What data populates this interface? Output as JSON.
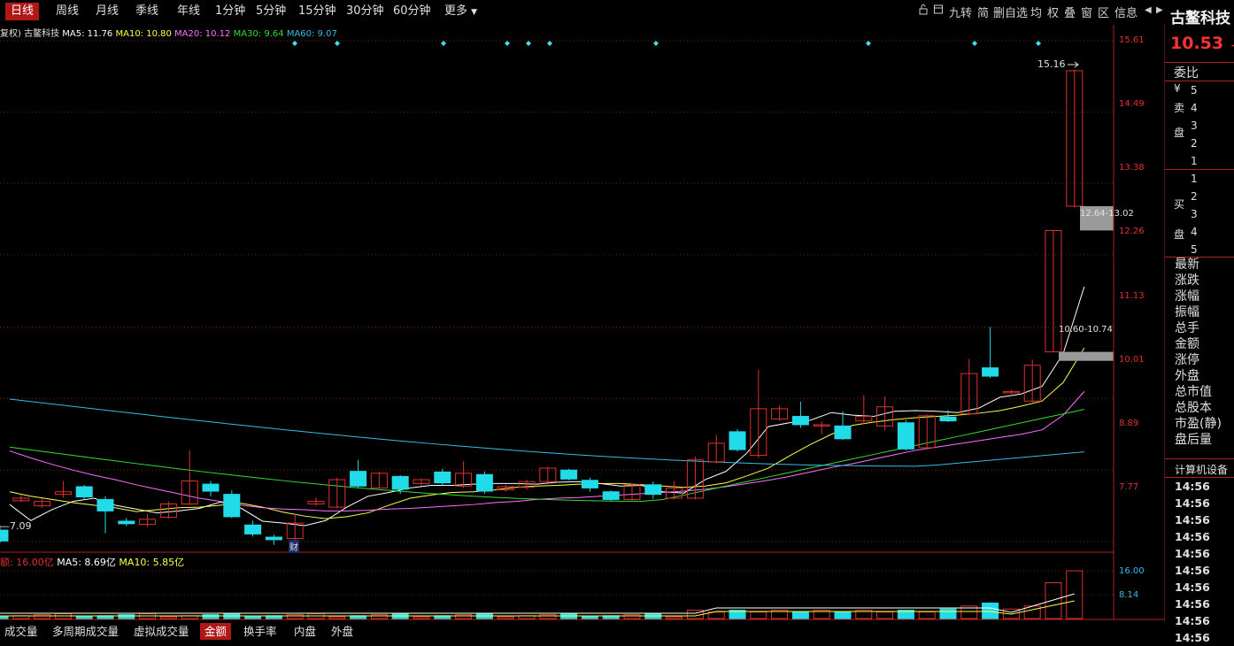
{
  "tabs": [
    "日线",
    "周线",
    "月线",
    "季线",
    "年线",
    "1分钟",
    "5分钟",
    "15分钟",
    "30分钟",
    "60分钟",
    "更多"
  ],
  "active_tab": 0,
  "toolbar": {
    "icons": [
      "lock-icon",
      "window-icon"
    ],
    "items": [
      "九转",
      "简",
      "删自选",
      "均",
      "权",
      "叠",
      "窗",
      "区",
      "信息"
    ],
    "prev_icon": "triangle-left-icon",
    "next_icon": "triangle-right-icon"
  },
  "stock": {
    "name": "古鳌科技",
    "price": "10.53",
    "price_suffix": "+"
  },
  "ma_line": {
    "prefix": "复权) 古鳌科技",
    "ma5": "MA5: 11.76",
    "ma10": "MA10: 10.80",
    "ma20": "MA20: 10.12",
    "ma30": "MA30: 9.64",
    "ma60": "MA60: 9.07"
  },
  "vol_line": {
    "label": "额: 16.00亿",
    "ma5": "MA5: 8.69亿",
    "ma10": "MA10: 5.85亿"
  },
  "price_axis": [
    "15.61",
    "14.49",
    "13.38",
    "12.26",
    "11.13",
    "10.01",
    "8.89",
    "7.77"
  ],
  "vol_axis": [
    "16.00",
    "8.14"
  ],
  "annotations": {
    "high": "15.16",
    "low_left": "7.09",
    "zone_upper": "12.64-13.02",
    "zone_lower": "10.60-10.74",
    "fin_marker": "财"
  },
  "right_panel": {
    "weibi": "委比",
    "sell_side": [
      "¥",
      "卖",
      "盘"
    ],
    "buy_side": [
      "买",
      "盘"
    ],
    "sell_levels": [
      "5",
      "4",
      "3",
      "2",
      "1"
    ],
    "buy_levels": [
      "1",
      "2",
      "3",
      "4",
      "5"
    ],
    "stats": [
      "最新",
      "涨跌",
      "涨幅",
      "振幅",
      "总手",
      "金额",
      "涨停",
      "外盘",
      "总市值",
      "总股本",
      "市盈(静)",
      "盘后量"
    ],
    "section": "计算机设备",
    "ticks": [
      "14:56",
      "14:56",
      "14:56",
      "14:56",
      "14:56",
      "14:56",
      "14:56",
      "14:56",
      "14:56",
      "14:56"
    ]
  },
  "bottom_tabs": [
    "成交量",
    "多周期成交量",
    "虚拟成交量",
    "金额",
    "换手率",
    "内盘",
    "外盘"
  ],
  "bottom_active": 3,
  "colors": {
    "up": "#e03030",
    "down": "#22dbe8",
    "ma5": "#ffffff",
    "ma10": "#ffff40",
    "ma20": "#ff70ff",
    "ma30": "#33dd33",
    "ma60": "#38bbe6",
    "grid": "#7a1515"
  },
  "chart_data": {
    "type": "candlestick",
    "ylim": [
      7.0,
      15.8
    ],
    "candles": [
      {
        "o": 7.95,
        "c": 7.78,
        "h": 8.02,
        "l": 7.75
      },
      {
        "o": 8.41,
        "c": 8.45,
        "h": 8.5,
        "l": 8.39
      },
      {
        "o": 8.33,
        "c": 8.4,
        "h": 8.45,
        "l": 8.3
      },
      {
        "o": 8.51,
        "c": 8.55,
        "h": 8.72,
        "l": 8.46
      },
      {
        "o": 8.63,
        "c": 8.47,
        "h": 8.66,
        "l": 8.43
      },
      {
        "o": 8.43,
        "c": 8.25,
        "h": 8.48,
        "l": 7.9
      },
      {
        "o": 8.09,
        "c": 8.05,
        "h": 8.14,
        "l": 8.01
      },
      {
        "o": 8.04,
        "c": 8.12,
        "h": 8.2,
        "l": 8.0
      },
      {
        "o": 8.15,
        "c": 8.36,
        "h": 8.4,
        "l": 8.13
      },
      {
        "o": 8.36,
        "c": 8.72,
        "h": 9.2,
        "l": 8.34
      },
      {
        "o": 8.67,
        "c": 8.56,
        "h": 8.72,
        "l": 8.48
      },
      {
        "o": 8.51,
        "c": 8.16,
        "h": 8.57,
        "l": 8.14
      },
      {
        "o": 8.03,
        "c": 7.89,
        "h": 8.1,
        "l": 7.85
      },
      {
        "o": 7.84,
        "c": 7.8,
        "h": 7.88,
        "l": 7.72
      },
      {
        "o": 7.82,
        "c": 8.06,
        "h": 8.2,
        "l": 7.8
      },
      {
        "o": 8.36,
        "c": 8.4,
        "h": 8.46,
        "l": 8.33
      },
      {
        "o": 8.31,
        "c": 8.74,
        "h": 8.77,
        "l": 8.29
      },
      {
        "o": 8.87,
        "c": 8.64,
        "h": 9.05,
        "l": 8.61
      },
      {
        "o": 8.61,
        "c": 8.84,
        "h": 8.86,
        "l": 8.6
      },
      {
        "o": 8.79,
        "c": 8.59,
        "h": 8.81,
        "l": 8.52
      },
      {
        "o": 8.68,
        "c": 8.74,
        "h": 8.76,
        "l": 8.64
      },
      {
        "o": 8.86,
        "c": 8.69,
        "h": 8.91,
        "l": 8.64
      },
      {
        "o": 8.64,
        "c": 8.84,
        "h": 9.03,
        "l": 8.61
      },
      {
        "o": 8.82,
        "c": 8.56,
        "h": 8.87,
        "l": 8.52
      },
      {
        "o": 8.58,
        "c": 8.63,
        "h": 8.66,
        "l": 8.55
      },
      {
        "o": 8.62,
        "c": 8.71,
        "h": 8.74,
        "l": 8.59
      },
      {
        "o": 8.71,
        "c": 8.92,
        "h": 8.94,
        "l": 8.69
      },
      {
        "o": 8.89,
        "c": 8.75,
        "h": 8.91,
        "l": 8.73
      },
      {
        "o": 8.73,
        "c": 8.61,
        "h": 8.77,
        "l": 8.55
      },
      {
        "o": 8.55,
        "c": 8.43,
        "h": 8.57,
        "l": 8.4
      },
      {
        "o": 8.43,
        "c": 8.66,
        "h": 8.68,
        "l": 8.4
      },
      {
        "o": 8.66,
        "c": 8.51,
        "h": 8.71,
        "l": 8.44
      },
      {
        "o": 8.45,
        "c": 8.61,
        "h": 8.72,
        "l": 8.43
      },
      {
        "o": 8.45,
        "c": 9.05,
        "h": 9.1,
        "l": 8.43
      },
      {
        "o": 9.02,
        "c": 9.31,
        "h": 9.44,
        "l": 9.0
      },
      {
        "o": 9.49,
        "c": 9.21,
        "h": 9.53,
        "l": 9.18
      },
      {
        "o": 9.12,
        "c": 9.85,
        "h": 10.46,
        "l": 9.08
      },
      {
        "o": 9.69,
        "c": 9.85,
        "h": 9.9,
        "l": 9.66
      },
      {
        "o": 9.73,
        "c": 9.6,
        "h": 9.96,
        "l": 9.55
      },
      {
        "o": 9.58,
        "c": 9.6,
        "h": 9.65,
        "l": 9.45
      },
      {
        "o": 9.58,
        "c": 9.38,
        "h": 9.81,
        "l": 9.36
      },
      {
        "o": 9.66,
        "c": 9.73,
        "h": 10.06,
        "l": 9.61
      },
      {
        "o": 9.58,
        "c": 9.88,
        "h": 10.04,
        "l": 9.52
      },
      {
        "o": 9.63,
        "c": 9.22,
        "h": 9.67,
        "l": 9.2
      },
      {
        "o": 9.24,
        "c": 9.74,
        "h": 9.76,
        "l": 9.22
      },
      {
        "o": 9.72,
        "c": 9.66,
        "h": 9.83,
        "l": 9.64
      },
      {
        "o": 9.77,
        "c": 10.4,
        "h": 10.63,
        "l": 9.75
      },
      {
        "o": 10.49,
        "c": 10.36,
        "h": 11.13,
        "l": 10.33
      },
      {
        "o": 10.1,
        "c": 10.12,
        "h": 10.15,
        "l": 10.08
      },
      {
        "o": 9.97,
        "c": 10.53,
        "h": 10.62,
        "l": 9.95
      },
      {
        "o": 10.74,
        "c": 12.64,
        "h": 12.64,
        "l": 10.74
      },
      {
        "o": 13.02,
        "c": 15.14,
        "h": 15.16,
        "l": 13.0
      }
    ],
    "ma5": [
      8.35,
      8.1,
      8.27,
      8.4,
      8.45,
      8.34,
      8.28,
      8.22,
      8.25,
      8.29,
      8.39,
      8.29,
      8.09,
      8.06,
      8.02,
      8.1,
      8.31,
      8.48,
      8.54,
      8.61,
      8.65,
      8.65,
      8.67,
      8.68,
      8.68,
      8.67,
      8.7,
      8.71,
      8.68,
      8.64,
      8.65,
      8.55,
      8.53,
      8.74,
      8.87,
      9.16,
      9.57,
      9.63,
      9.67,
      9.79,
      9.75,
      9.73,
      9.81,
      9.82,
      9.81,
      9.79,
      9.86,
      10.03,
      10.08,
      10.2,
      10.71,
      11.76
    ],
    "ma10": [
      8.55,
      8.48,
      8.43,
      8.38,
      8.34,
      8.3,
      8.24,
      8.27,
      8.3,
      8.31,
      8.34,
      8.37,
      8.31,
      8.23,
      8.17,
      8.13,
      8.16,
      8.22,
      8.34,
      8.45,
      8.5,
      8.54,
      8.55,
      8.58,
      8.62,
      8.64,
      8.65,
      8.67,
      8.68,
      8.68,
      8.66,
      8.64,
      8.62,
      8.64,
      8.69,
      8.8,
      8.92,
      9.11,
      9.29,
      9.45,
      9.59,
      9.64,
      9.68,
      9.71,
      9.73,
      9.75,
      9.78,
      9.82,
      9.89,
      9.97,
      10.26,
      10.8
    ],
    "ma20": [
      9.19,
      9.08,
      8.98,
      8.89,
      8.81,
      8.74,
      8.66,
      8.59,
      8.52,
      8.45,
      8.4,
      8.34,
      8.3,
      8.28,
      8.27,
      8.25,
      8.25,
      8.26,
      8.28,
      8.29,
      8.31,
      8.33,
      8.35,
      8.38,
      8.4,
      8.43,
      8.45,
      8.46,
      8.48,
      8.5,
      8.52,
      8.54,
      8.56,
      8.59,
      8.63,
      8.68,
      8.73,
      8.79,
      8.86,
      8.93,
      8.99,
      9.06,
      9.13,
      9.2,
      9.25,
      9.3,
      9.35,
      9.4,
      9.45,
      9.52,
      9.75,
      10.12
    ]
  }
}
